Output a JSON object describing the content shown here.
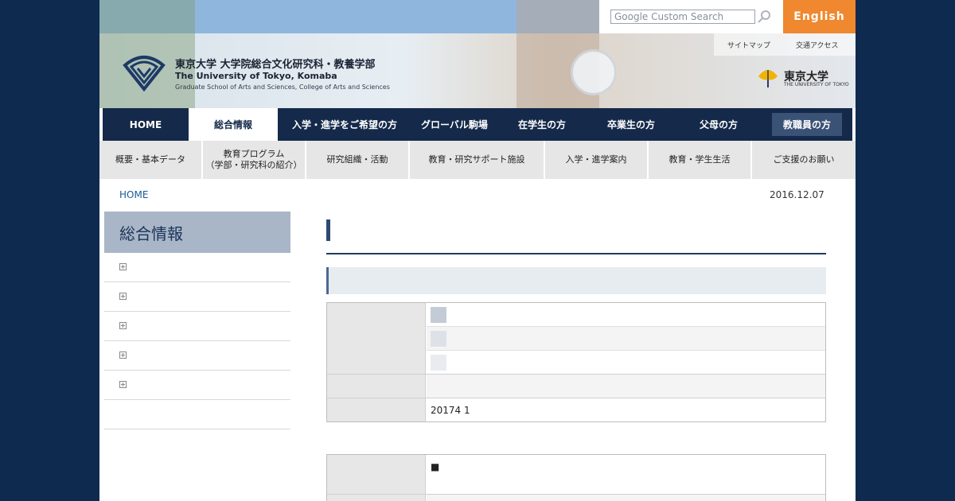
{
  "header": {
    "title_jp": "東京大学 大学院総合文化研究科・教養学部",
    "title_en": "The University of Tokyo, Komaba",
    "title_sub": "Graduate School of Arts and Sciences, College of Arts and Sciences",
    "search_placeholder": "Google Custom Search",
    "english_label": "English",
    "util_links": [
      "サイトマップ",
      "交通アクセス"
    ],
    "univ_logo_text": "東京大学",
    "univ_logo_sub": "THE UNIVERSITY OF TOKYO"
  },
  "mainnav": {
    "items": [
      "HOME",
      "総合情報",
      "入学・進学をご希望の方",
      "グローバル駒場",
      "在学生の方",
      "卒業生の方",
      "父母の方",
      "教職員の方"
    ]
  },
  "subnav": {
    "items": [
      "概要・基本データ",
      "教育プログラム\n（学部・研究科の紹介）",
      "研究組織・活動",
      "教育・研究サポート施設",
      "入学・進学案内",
      "教育・学生生活",
      "ご支援のお願い"
    ]
  },
  "breadcrumb": "HOME",
  "date": "2016.12.07",
  "sidebar": {
    "title": "総合情報"
  },
  "table1": {
    "date_value": "20174 1"
  },
  "table2": {
    "bullet": "■"
  },
  "colors": {
    "nav_bg": "#152a4a",
    "accent_orange": "#f0882f",
    "sidebar_head": "#a9b6c7",
    "page_bg": "#0f2a4f"
  }
}
